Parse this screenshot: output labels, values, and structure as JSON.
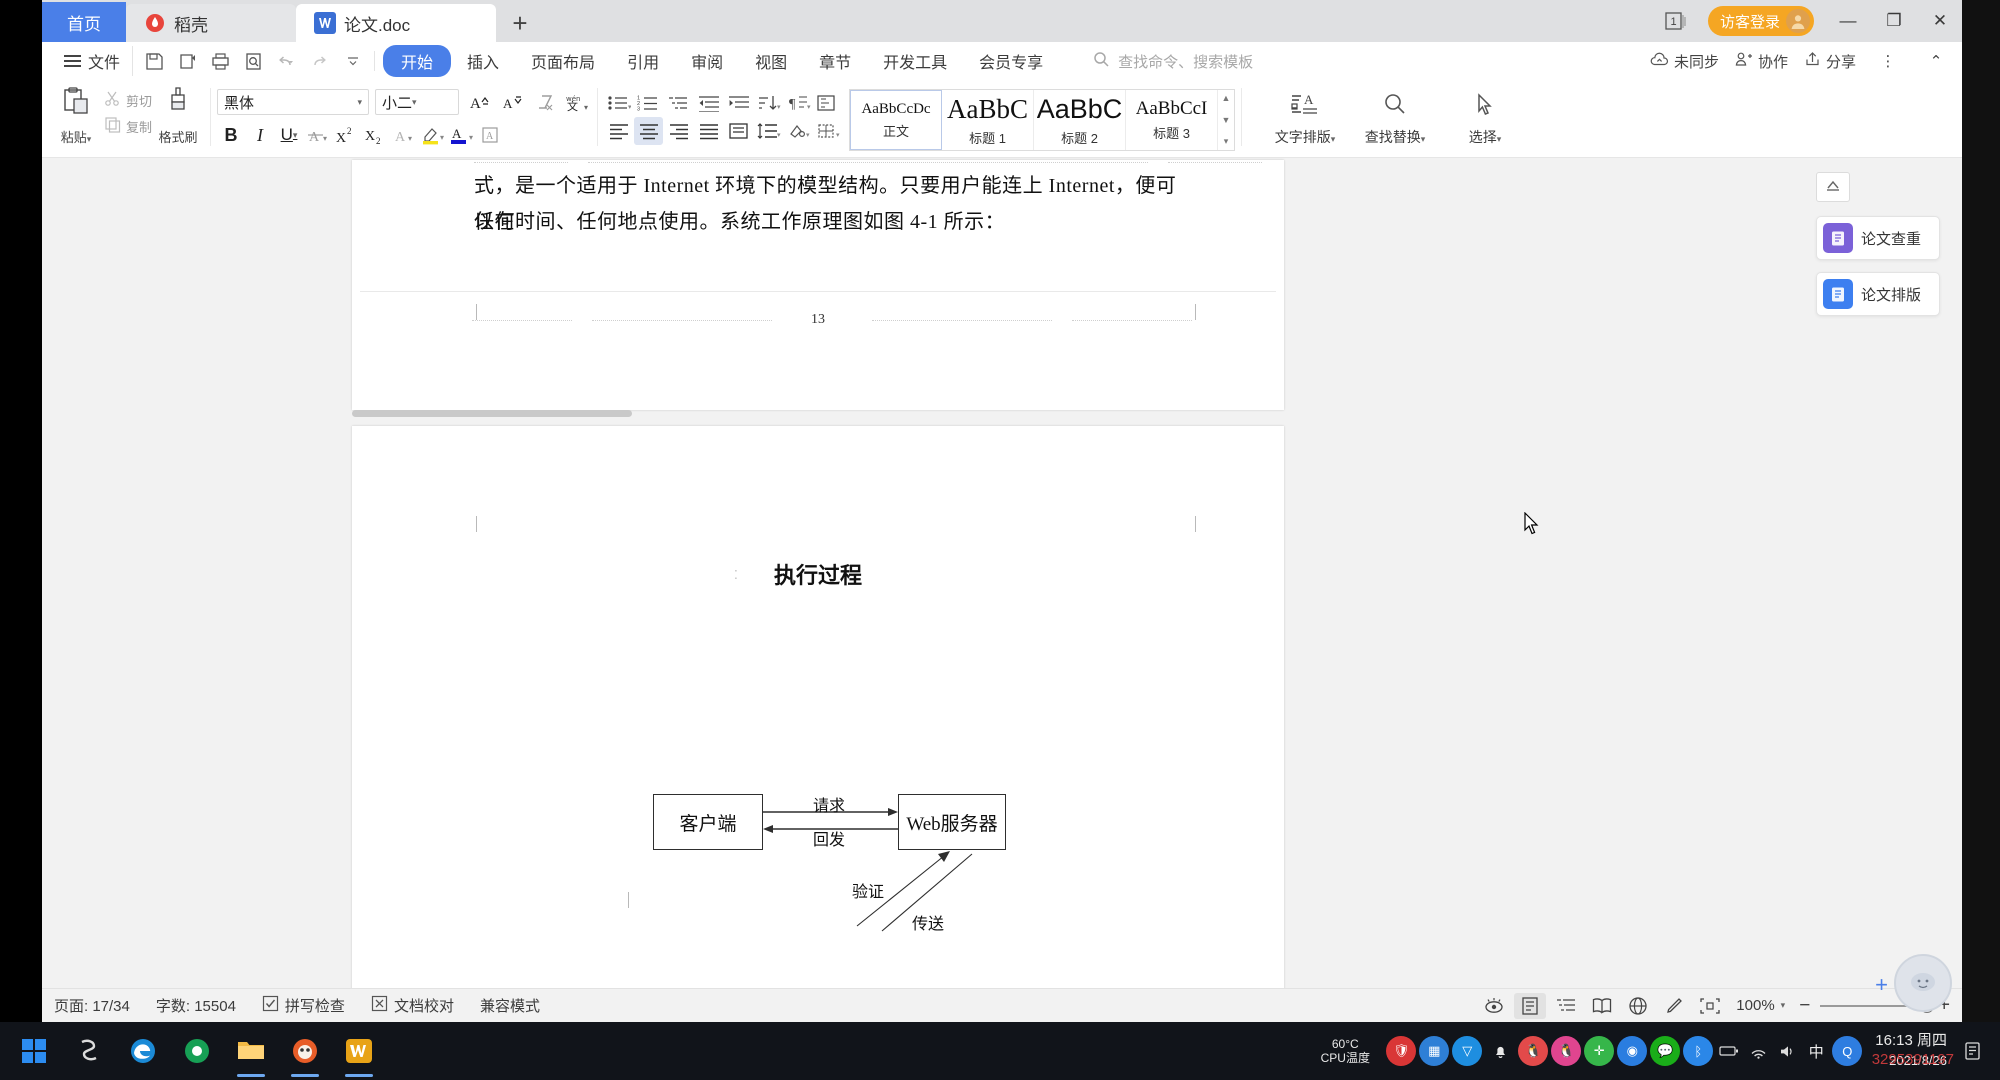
{
  "window": {
    "tabs": [
      {
        "label": "首页",
        "icon": "home-icon",
        "active": false
      },
      {
        "label": "稻壳",
        "icon": "docer-icon",
        "active": false
      },
      {
        "label": "论文.doc",
        "icon": "wps-doc-icon",
        "active": true
      }
    ],
    "add_tab_label": "+",
    "doc_count_badge": "1",
    "login_label": "访客登录",
    "minimize": "—",
    "restore": "❐",
    "close": "✕"
  },
  "menubar": {
    "file_label": "文件",
    "quick_access": [
      "save-icon",
      "print-preview-icon",
      "print-icon",
      "find-icon",
      "undo-icon",
      "redo-icon",
      "customize-icon"
    ],
    "items": [
      {
        "label": "开始",
        "active": true
      },
      {
        "label": "插入",
        "active": false
      },
      {
        "label": "页面布局",
        "active": false
      },
      {
        "label": "引用",
        "active": false
      },
      {
        "label": "审阅",
        "active": false
      },
      {
        "label": "视图",
        "active": false
      },
      {
        "label": "章节",
        "active": false
      },
      {
        "label": "开发工具",
        "active": false
      },
      {
        "label": "会员专享",
        "active": false
      }
    ],
    "search_placeholder": "查找命令、搜索模板",
    "right_items": [
      {
        "label": "未同步",
        "icon": "cloud-icon"
      },
      {
        "label": "协作",
        "icon": "collab-icon"
      },
      {
        "label": "分享",
        "icon": "share-icon"
      }
    ],
    "more_icon": "⋮",
    "collapse_icon": "⌃"
  },
  "ribbon": {
    "paste_label": "粘贴",
    "cut_label": "剪切",
    "copy_label": "复制",
    "format_painter_label": "格式刷",
    "font_name": "黑体",
    "font_size": "小二",
    "grow_font": "A",
    "shrink_font": "A",
    "clear_format_icon": "clear-format-icon",
    "pinyin_icon": "pinyin-icon",
    "bold": "B",
    "italic": "I",
    "underline": "U",
    "strikethrough": "A",
    "superscript": "X²",
    "subscript": "X₂",
    "char_border_icon": "char-border-icon",
    "highlight_icon": "highlight-icon",
    "font_color_icon": "font-color-icon",
    "char_shading_icon": "char-shading-icon",
    "styles": [
      {
        "sample": "AaBbCcDc",
        "label": "正文",
        "size": "15px",
        "selected": true
      },
      {
        "sample": "AaBbC",
        "label": "标题 1",
        "size": "27px",
        "selected": false
      },
      {
        "sample": "AaBbC",
        "label": "标题 2",
        "size": "27px",
        "selected": false
      },
      {
        "sample": "AaBbCcI",
        "label": "标题 3",
        "size": "19px",
        "selected": false
      }
    ],
    "right_tools": [
      {
        "label": "文字排版",
        "icon": "text-layout-icon"
      },
      {
        "label": "查找替换",
        "icon": "find-replace-icon"
      },
      {
        "label": "选择",
        "icon": "select-pointer-icon"
      }
    ]
  },
  "document": {
    "page1": {
      "lines": [
        "式，是一个适用于 Internet 环境下的模型结构。只要用户能连上 Internet，便可以在",
        "任何时间、任何地点使用。系统工作原理图如图 4-1 所示："
      ],
      "page_number": "13"
    },
    "page2": {
      "figure_title": "执行过程",
      "boxes": [
        {
          "name": "client-box",
          "label": "客户端"
        },
        {
          "name": "web-server-box",
          "label": "Web服务器"
        }
      ],
      "arrow_labels": [
        "请求",
        "回发",
        "验证",
        "传送"
      ]
    }
  },
  "task_panel": {
    "collapse_icon": "collapse-panel-icon",
    "cards": [
      {
        "label": "论文查重",
        "icon": "check-duplicate-icon",
        "color": "#7b61d8"
      },
      {
        "label": "论文排版",
        "icon": "layout-doc-icon",
        "color": "#3d7ff0"
      }
    ]
  },
  "statusbar": {
    "page_info": "页面: 17/34",
    "word_count": "字数: 15504",
    "spell_check": "拼写检查",
    "doc_proof": "文档校对",
    "compat_mode": "兼容模式",
    "view_icons": [
      "eye-icon",
      "page-view-icon",
      "outline-view-icon",
      "reading-view-icon",
      "web-view-icon",
      "edit-pen-icon",
      "fit-screen-icon"
    ],
    "zoom_level": "100%",
    "zoom_minus": "−",
    "zoom_plus": "+"
  },
  "taskbar": {
    "start_icon": "windows-start-icon",
    "apps": [
      "app-s-icon",
      "edge-icon",
      "browser-icon",
      "file-explorer-icon",
      "firefox-icon",
      "wps-icon"
    ],
    "cpu_temp_value": "60°C",
    "cpu_temp_label": "CPU温度",
    "tray_icons": [
      "shield-red-icon",
      "net-icon",
      "security-icon",
      "bell-icon",
      "qq-icon",
      "qq-pink-icon",
      "plus-green-icon",
      "settings-blue-icon",
      "wechat-icon",
      "bluetooth-icon",
      "battery-icon",
      "wifi-icon",
      "volume-icon",
      "ime-cn-icon",
      "search-blue-icon"
    ],
    "clock_time": "16:13 周四",
    "clock_date": "2021/8/26",
    "notification_icon": "notification-icon"
  },
  "watermark": "3295391197",
  "colors": {
    "accent": "#4a7fe8",
    "login_orange": "#f5a623",
    "titlebar_bg": "#dfe0e2",
    "doc_bg": "#f2f2f2"
  }
}
